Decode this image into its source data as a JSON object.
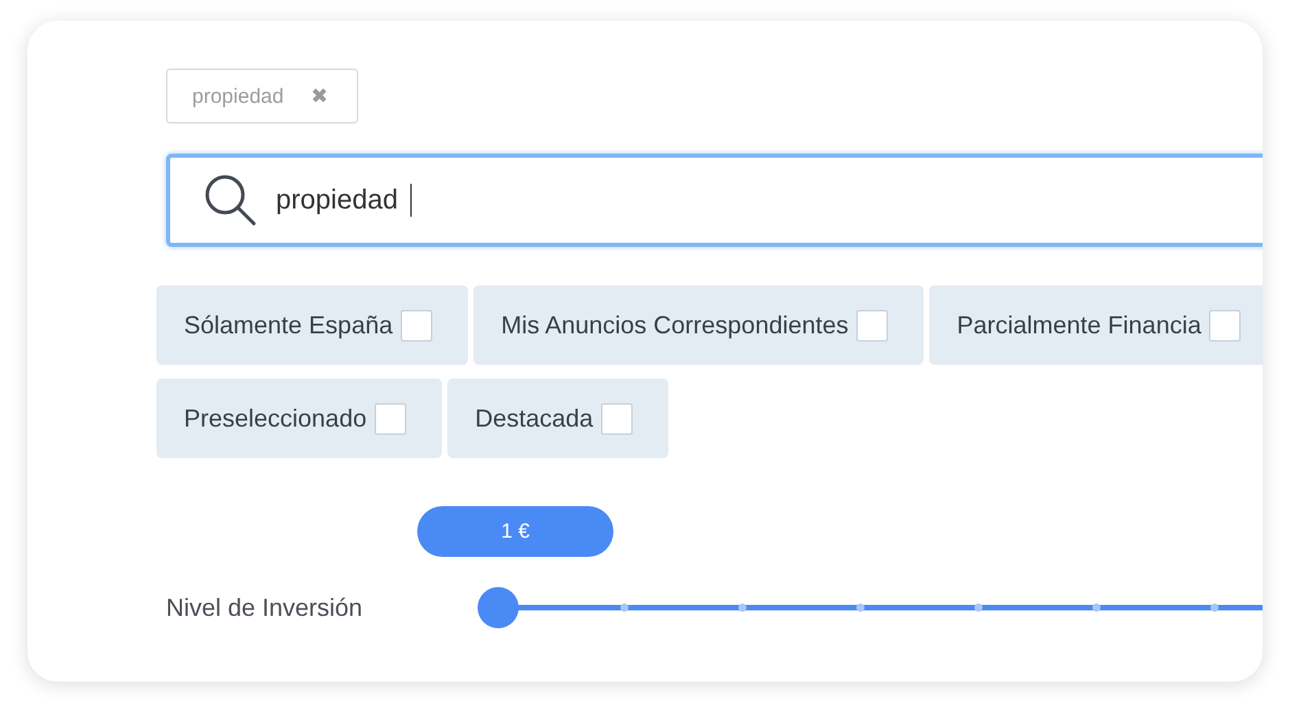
{
  "tag": {
    "label": "propiedad",
    "close": "✖"
  },
  "search": {
    "value": "propiedad"
  },
  "filters": [
    {
      "label": "Sólamente España",
      "checked": false
    },
    {
      "label": "Mis Anuncios Correspondientes",
      "checked": false
    },
    {
      "label": "Parcialmente Financia",
      "checked": false
    },
    {
      "label": "Preseleccionado",
      "checked": false
    },
    {
      "label": "Destacada",
      "checked": false
    }
  ],
  "slider": {
    "label": "Nivel de Inversión",
    "value_bubble": "1 €",
    "level": 0
  }
}
